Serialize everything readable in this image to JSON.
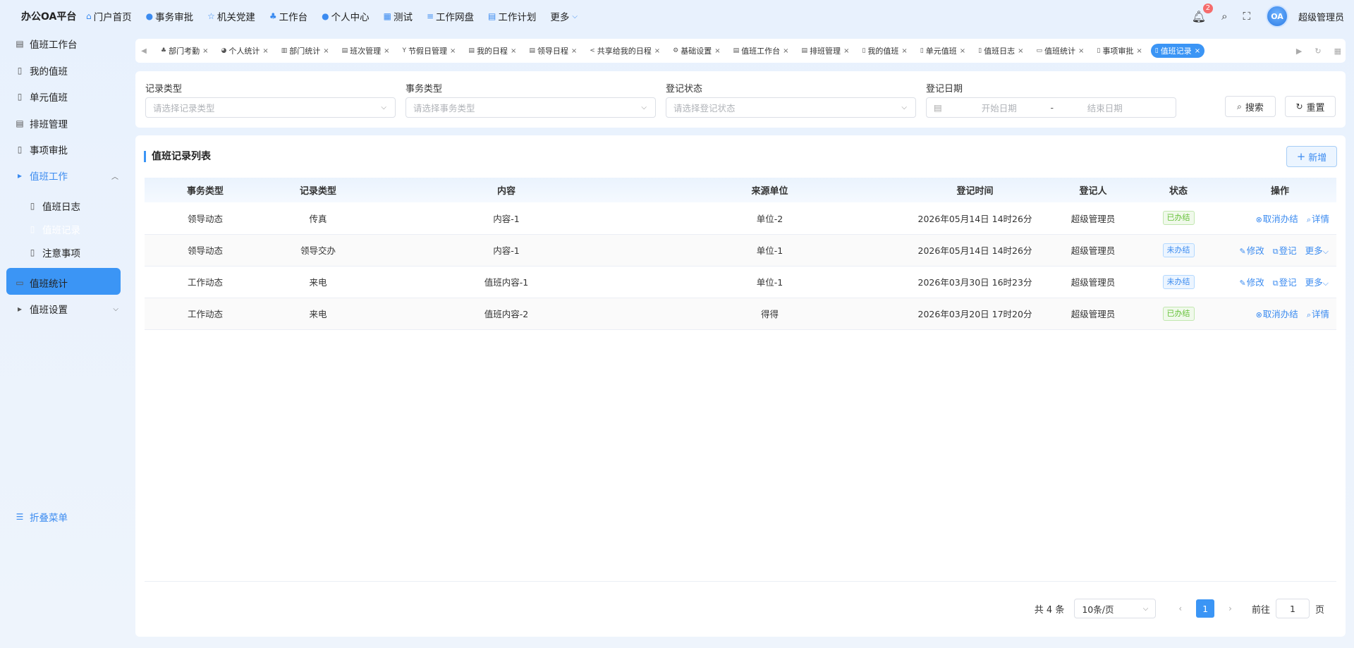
{
  "brand": "办公OA平台",
  "top_nav": [
    {
      "label": "门户首页",
      "icon": "home-icon",
      "glyph": "⌂"
    },
    {
      "label": "事务审批",
      "icon": "info-icon",
      "glyph": "●"
    },
    {
      "label": "机关党建",
      "icon": "star-icon",
      "glyph": "☆"
    },
    {
      "label": "工作台",
      "icon": "org-icon",
      "glyph": "♣"
    },
    {
      "label": "个人中心",
      "icon": "user-icon",
      "glyph": "●"
    },
    {
      "label": "测试",
      "icon": "grid-icon",
      "glyph": "▦"
    },
    {
      "label": "工作网盘",
      "icon": "database-icon",
      "glyph": "≡"
    },
    {
      "label": "工作计划",
      "icon": "calendar-icon",
      "glyph": "▤"
    },
    {
      "label": "更多",
      "icon": "chevron-down-icon",
      "glyph": ""
    }
  ],
  "header": {
    "notification_count": "2",
    "avatar_text": "OA",
    "username": "超级管理员"
  },
  "sidebar": {
    "items": [
      {
        "label": "值班工作台",
        "icon": "calendar-icon",
        "glyph": "▤"
      },
      {
        "label": "我的值班",
        "icon": "document-icon",
        "glyph": "▯"
      },
      {
        "label": "单元值班",
        "icon": "document-icon",
        "glyph": "▯"
      },
      {
        "label": "排班管理",
        "icon": "calendar-icon",
        "glyph": "▤"
      },
      {
        "label": "事项审批",
        "icon": "document-icon",
        "glyph": "▯"
      },
      {
        "label": "值班工作",
        "icon": "caret-right-icon",
        "glyph": "▸"
      },
      {
        "label": "值班日志",
        "icon": "document-icon",
        "glyph": "▯"
      },
      {
        "label": "值班记录",
        "icon": "document-icon",
        "glyph": "▯"
      },
      {
        "label": "注意事项",
        "icon": "document-icon",
        "glyph": "▯"
      },
      {
        "label": "值班统计",
        "icon": "presentation-icon",
        "glyph": "▭"
      },
      {
        "label": "值班设置",
        "icon": "caret-right-icon",
        "glyph": "▸"
      }
    ],
    "collapse_label": "折叠菜单"
  },
  "tabs": [
    {
      "label": "部门考勤",
      "glyph": "♣"
    },
    {
      "label": "个人统计",
      "glyph": "◕"
    },
    {
      "label": "部门统计",
      "glyph": "▥"
    },
    {
      "label": "班次管理",
      "glyph": "▤"
    },
    {
      "label": "节假日管理",
      "glyph": "Y"
    },
    {
      "label": "我的日程",
      "glyph": "▤"
    },
    {
      "label": "领导日程",
      "glyph": "▤"
    },
    {
      "label": "共享给我的日程",
      "glyph": "<"
    },
    {
      "label": "基础设置",
      "glyph": "⚙"
    },
    {
      "label": "值班工作台",
      "glyph": "▤"
    },
    {
      "label": "排班管理",
      "glyph": "▤"
    },
    {
      "label": "我的值班",
      "glyph": "▯"
    },
    {
      "label": "单元值班",
      "glyph": "▯"
    },
    {
      "label": "值班日志",
      "glyph": "▯"
    },
    {
      "label": "值班统计",
      "glyph": "▭"
    },
    {
      "label": "事项审批",
      "glyph": "▯"
    },
    {
      "label": "值班记录",
      "glyph": "▯"
    }
  ],
  "filters": {
    "record_type": {
      "label": "记录类型",
      "placeholder": "请选择记录类型"
    },
    "affair_type": {
      "label": "事务类型",
      "placeholder": "请选择事务类型"
    },
    "reg_status": {
      "label": "登记状态",
      "placeholder": "请选择登记状态"
    },
    "reg_date": {
      "label": "登记日期",
      "start_placeholder": "开始日期",
      "separator": "-",
      "end_placeholder": "结束日期"
    },
    "search_label": "搜索",
    "reset_label": "重置"
  },
  "list": {
    "title": "值班记录列表",
    "add_label": "新增",
    "columns": [
      "事务类型",
      "记录类型",
      "内容",
      "来源单位",
      "登记时间",
      "登记人",
      "状态",
      "操作"
    ],
    "rows": [
      {
        "affair": "领导动态",
        "record": "传真",
        "content": "内容-1",
        "source": "单位-2",
        "time": "2026年05月14日 14时26分",
        "person": "超级管理员",
        "status": "已办结",
        "status_kind": "done",
        "ops": [
          "取消办结",
          "详情"
        ],
        "op_icons": [
          "cancel-circle-icon",
          "search-icon"
        ]
      },
      {
        "affair": "领导动态",
        "record": "领导交办",
        "content": "内容-1",
        "source": "单位-1",
        "time": "2026年05月14日 14时26分",
        "person": "超级管理员",
        "status": "未办结",
        "status_kind": "todo",
        "ops": [
          "修改",
          "登记",
          "更多"
        ],
        "op_icons": [
          "edit-icon",
          "register-icon",
          "chevron-down-icon"
        ]
      },
      {
        "affair": "工作动态",
        "record": "来电",
        "content": "值班内容-1",
        "source": "单位-1",
        "time": "2026年03月30日 16时23分",
        "person": "超级管理员",
        "status": "未办结",
        "status_kind": "todo",
        "ops": [
          "修改",
          "登记",
          "更多"
        ],
        "op_icons": [
          "edit-icon",
          "register-icon",
          "chevron-down-icon"
        ]
      },
      {
        "affair": "工作动态",
        "record": "来电",
        "content": "值班内容-2",
        "source": "得得",
        "time": "2026年03月20日 17时20分",
        "person": "超级管理员",
        "status": "已办结",
        "status_kind": "done",
        "ops": [
          "取消办结",
          "详情"
        ],
        "op_icons": [
          "cancel-circle-icon",
          "search-icon"
        ]
      }
    ]
  },
  "pagination": {
    "total": "共 4 条",
    "page_size": "10条/页",
    "current_page": "1",
    "goto_label": "前往",
    "goto_value": "1",
    "page_suffix": "页"
  },
  "colors": {
    "accent": "#3b95f5",
    "done": "#67c23a",
    "badge": "#f56c6c"
  }
}
